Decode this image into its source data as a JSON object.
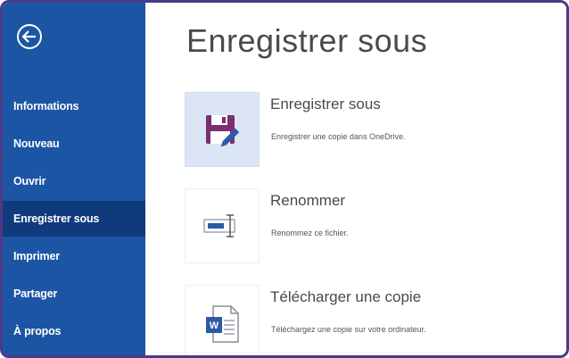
{
  "sidebar": {
    "items": [
      {
        "label": "Informations"
      },
      {
        "label": "Nouveau"
      },
      {
        "label": "Ouvrir"
      },
      {
        "label": "Enregistrer sous",
        "selected": true
      },
      {
        "label": "Imprimer"
      },
      {
        "label": "Partager"
      },
      {
        "label": "À propos"
      }
    ]
  },
  "main": {
    "title": "Enregistrer sous",
    "options": [
      {
        "title": "Enregistrer sous",
        "description": "Enregistrer une copie dans OneDrive.",
        "icon": "save-edit-icon"
      },
      {
        "title": "Renommer",
        "description": "Renommez ce fichier.",
        "icon": "rename-icon"
      },
      {
        "title": "Télécharger une copie",
        "description": "Téléchargez une copie sur votre ordinateur.",
        "icon": "word-document-icon"
      }
    ]
  },
  "colors": {
    "sidebar": "#1c55a3",
    "sidebar_selected": "#0f3b7c",
    "frame_border": "#4a3a86",
    "save_icon": "#7b2f6f"
  }
}
